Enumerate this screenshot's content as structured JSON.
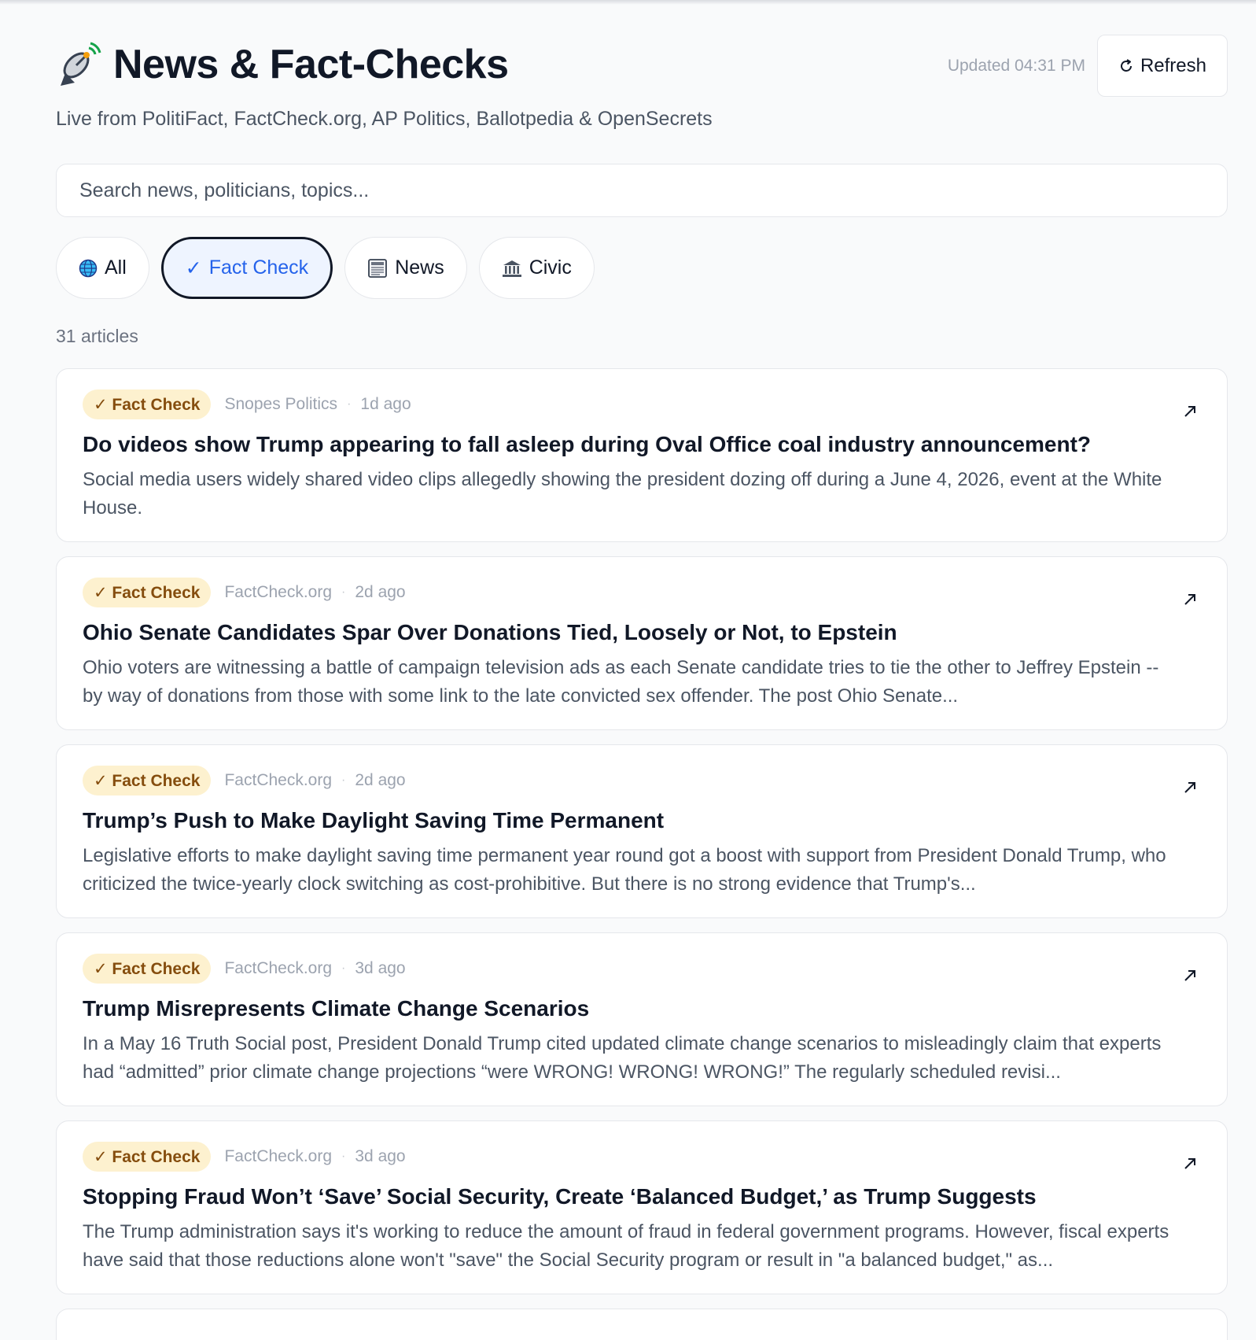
{
  "header": {
    "title": "News & Fact-Checks",
    "logo_icon": "satellite-dish-icon",
    "subtitle": "Live from PolitiFact, FactCheck.org, AP Politics, Ballotpedia & OpenSecrets",
    "updated": "Updated 04:31 PM",
    "refresh_label": "Refresh"
  },
  "search": {
    "placeholder": "Search news, politicians, topics..."
  },
  "filters": [
    {
      "label": "All",
      "icon": "globe-icon",
      "active": false
    },
    {
      "label": "Fact Check",
      "icon": "check-icon",
      "active": true
    },
    {
      "label": "News",
      "icon": "newspaper-icon",
      "active": false
    },
    {
      "label": "Civic",
      "icon": "classical-building-icon",
      "active": false
    }
  ],
  "article_count": "31 articles",
  "articles": [
    {
      "badge": "✓ Fact Check",
      "source": "Snopes Politics",
      "time": "1d ago",
      "title": "Do videos show Trump appearing to fall asleep during Oval Office coal industry announcement?",
      "description": "Social media users widely shared video clips allegedly showing the president dozing off during a June 4, 2026, event at the White House."
    },
    {
      "badge": "✓ Fact Check",
      "source": "FactCheck.org",
      "time": "2d ago",
      "title": "Ohio Senate Candidates Spar Over Donations Tied, Loosely or Not, to Epstein",
      "description": "Ohio voters are witnessing a battle of campaign television ads as each Senate candidate tries to tie the other to Jeffrey Epstein -- by way of donations from those with some link to the late convicted sex offender. The post Ohio Senate..."
    },
    {
      "badge": "✓ Fact Check",
      "source": "FactCheck.org",
      "time": "2d ago",
      "title": "Trump’s Push to Make Daylight Saving Time Permanent",
      "description": "Legislative efforts to make daylight saving time permanent year round got a boost with support from President Donald Trump, who criticized the twice-yearly clock switching as cost-prohibitive. But there is no strong evidence that Trump's..."
    },
    {
      "badge": "✓ Fact Check",
      "source": "FactCheck.org",
      "time": "3d ago",
      "title": "Trump Misrepresents Climate Change Scenarios",
      "description": "In a May 16 Truth Social post, President Donald Trump cited updated climate change scenarios to misleadingly claim that experts had “admitted” prior climate change projections “were WRONG! WRONG! WRONG!” The regularly scheduled revisi..."
    },
    {
      "badge": "✓ Fact Check",
      "source": "FactCheck.org",
      "time": "3d ago",
      "title": "Stopping Fraud Won’t ‘Save’ Social Security, Create ‘Balanced Budget,’ as Trump Suggests",
      "description": "The Trump administration says it's working to reduce the amount of fraud in federal government programs. However, fiscal experts have said that those reductions alone won't \"save\" the Social Security program or result in \"a balanced budget,\" as..."
    }
  ],
  "colors": {
    "accent": "#2563eb",
    "badge_bg": "#fdf1cf",
    "badge_text": "#854d0e",
    "page_bg": "#f9fafb"
  }
}
